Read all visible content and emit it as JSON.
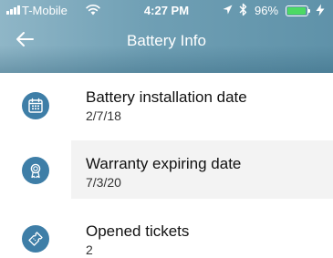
{
  "status_bar": {
    "carrier": "T-Mobile",
    "time": "4:27 PM",
    "battery_percent": "96%",
    "battery_level": 0.96,
    "battery_color": "#4cd964",
    "icons": [
      "signal-bars",
      "wifi",
      "location-arrow",
      "bluetooth",
      "battery",
      "charging-bolt"
    ]
  },
  "nav": {
    "title": "Battery Info",
    "back_icon": "arrow-left"
  },
  "colors": {
    "icon_circle": "#3e7ea7",
    "header_accent": "#6f9fb4",
    "highlight_row": "#f3f3f3"
  },
  "items": [
    {
      "title": "Battery installation date",
      "value": "2/7/18",
      "icon": "calendar"
    },
    {
      "title": "Warranty expiring date",
      "value": "7/3/20",
      "icon": "award-ribbon"
    },
    {
      "title": "Opened tickets",
      "value": "2",
      "icon": "ticket"
    }
  ]
}
